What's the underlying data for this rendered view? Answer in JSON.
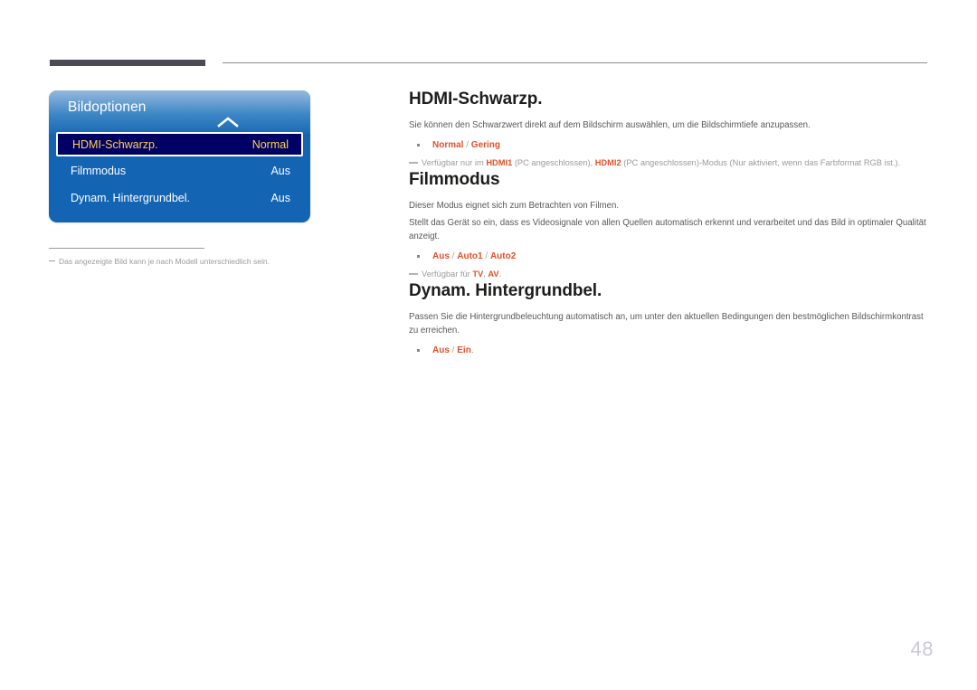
{
  "page": {
    "number": "48"
  },
  "osd": {
    "title": "Bildoptionen",
    "rows": [
      {
        "label": "HDMI-Schwarzp.",
        "value": "Normal",
        "selected": true
      },
      {
        "label": "Filmmodus",
        "value": "Aus",
        "selected": false
      },
      {
        "label": "Dynam. Hintergrundbel.",
        "value": "Aus",
        "selected": false
      }
    ],
    "footnote": "Das angezeigte Bild kann je nach Modell unterschiedlich sein."
  },
  "sections": [
    {
      "title": "HDMI-Schwarzp.",
      "paragraph": "Sie können den Schwarzwert direkt auf dem Bildschirm auswählen, um die Bildschirmtiefe anzupassen.",
      "options": "Normal / Gering",
      "option_parts": {
        "first": "Normal",
        "sep": " / ",
        "second": "Gering"
      },
      "note_parts": {
        "lead": "Verfügbar nur im ",
        "bold1": "HDMI1",
        "mid": " (PC angeschlossen), ",
        "bold2": "HDMI2",
        "tail": " (PC angeschlossen)-Modus (Nur aktiviert, wenn das Farbformat RGB ist.)."
      }
    },
    {
      "title": "Filmmodus",
      "paragraph1": "Dieser Modus eignet sich zum Betrachten von Filmen.",
      "paragraph2": "Stellt das Gerät so ein, dass es Videosignale von allen Quellen automatisch erkennt und verarbeitet und das Bild in optimaler Qualität anzeigt.",
      "option_parts": {
        "first": "Aus",
        "sep": " / ",
        "second": "Auto1",
        "sep2": " / ",
        "third": "Auto2"
      },
      "note_parts": {
        "lead": "Verfügbar für ",
        "bold1": "TV",
        "mid": ", ",
        "bold2": "AV",
        "tail": "."
      }
    },
    {
      "title": "Dynam. Hintergrundbel.",
      "paragraph": "Passen Sie die Hintergrundbeleuchtung automatisch an, um unter den aktuellen Bedingungen den bestmöglichen Bildschirmkontrast zu erreichen.",
      "option_parts": {
        "first": "Aus",
        "sep": " / ",
        "second": "Ein",
        "tail": "."
      }
    }
  ],
  "colors": {
    "accent_orange": "#e0512a",
    "panel_blue": "#1464b4",
    "selected_navy": "#000064",
    "selected_text": "#ffd24d",
    "body_gray": "#58585a",
    "note_gray": "#9b9b9f",
    "rule_dark": "#4a4a58",
    "page_number": "#c9c9d2"
  },
  "icons": {
    "chevron_up": "chevron-up-icon"
  }
}
